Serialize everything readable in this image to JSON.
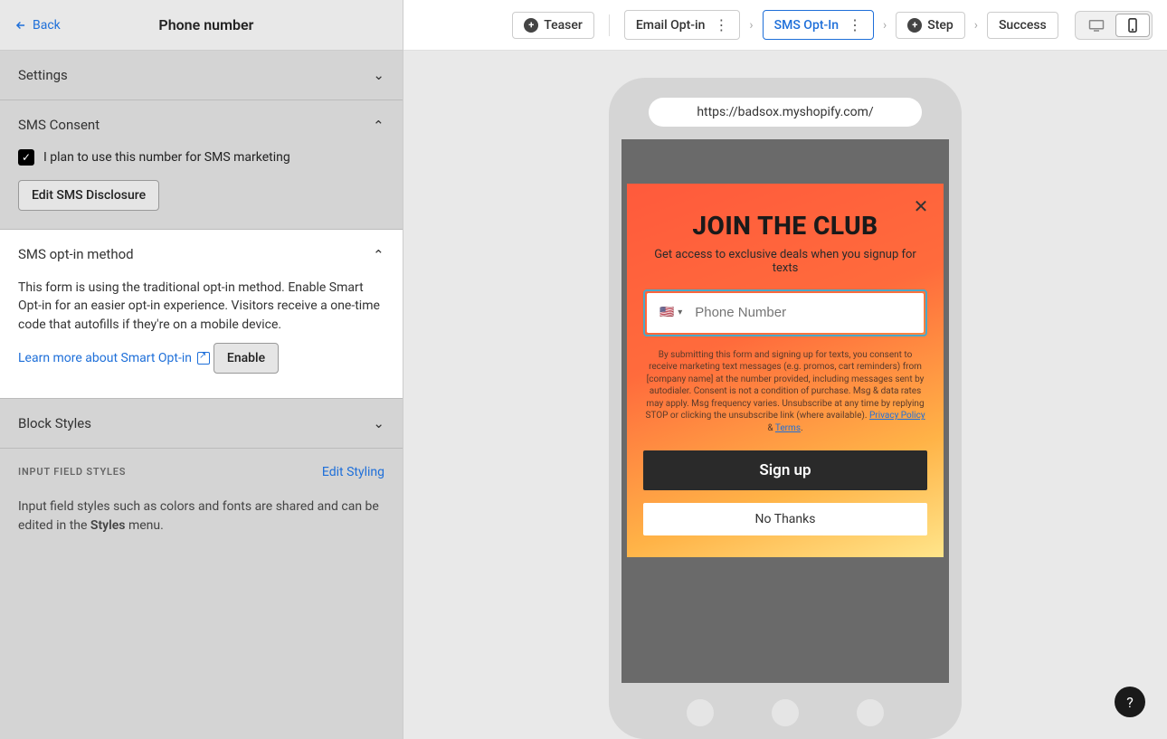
{
  "sidebar": {
    "back_label": "Back",
    "title": "Phone number",
    "sections": {
      "settings": {
        "label": "Settings"
      },
      "sms_consent": {
        "label": "SMS Consent",
        "checkbox_label": "I plan to use this number for SMS marketing",
        "edit_btn": "Edit SMS Disclosure"
      },
      "optin_method": {
        "label": "SMS opt-in method",
        "description": "This form is using the traditional opt-in method. Enable Smart Opt-in for an easier opt-in experience. Visitors receive a one-time code that autofills if they're on a mobile device.",
        "learn_more": "Learn more about Smart Opt-in",
        "enable_btn": "Enable"
      },
      "block_styles": {
        "label": "Block Styles"
      },
      "input_styles": {
        "label": "INPUT FIELD STYLES",
        "edit_link": "Edit Styling",
        "desc_prefix": "Input field styles such as colors and fonts are shared and can be edited in the ",
        "desc_bold": "Styles",
        "desc_suffix": " menu."
      }
    }
  },
  "topbar": {
    "teaser": "Teaser",
    "email_optin": "Email Opt-in",
    "sms_optin": "SMS Opt-In",
    "step": "Step",
    "success": "Success"
  },
  "preview": {
    "url": "https://badsox.myshopify.com/",
    "popup": {
      "title": "JOIN THE CLUB",
      "subtitle": "Get access to exclusive deals when you signup for texts",
      "phone_placeholder": "Phone Number",
      "flag": "🇺🇸",
      "disclosure_1": "By submitting this form and signing up for texts, you consent to receive marketing text messages (e.g. promos, cart reminders) from [company name] at the number provided, including messages sent by autodialer. Consent is not a condition of purchase. Msg & data rates may apply. Msg frequency varies. Unsubscribe at any time by replying STOP or clicking the unsubscribe link (where available). ",
      "privacy": "Privacy Policy",
      "amp": " & ",
      "terms": "Terms",
      "dot": ".",
      "signup_btn": "Sign up",
      "no_thanks_btn": "No Thanks"
    }
  },
  "help": "?"
}
